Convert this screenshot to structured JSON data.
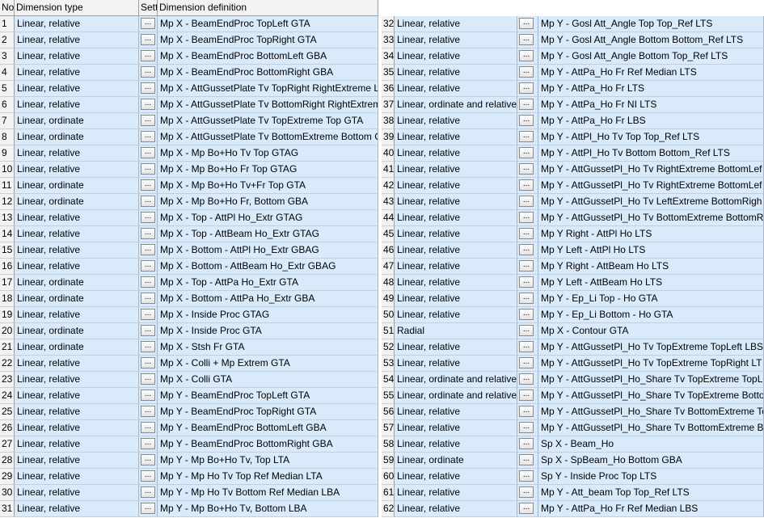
{
  "header": {
    "no": "No",
    "type": "Dimension type",
    "set": "Sett",
    "def": "Dimension definition"
  },
  "settings_button_label": "...",
  "left_rows": [
    {
      "no": "1",
      "type": "Linear, relative",
      "def": "Mp X - BeamEndProc TopLeft GTA"
    },
    {
      "no": "2",
      "type": "Linear, relative",
      "def": "Mp X - BeamEndProc TopRight GTA"
    },
    {
      "no": "3",
      "type": "Linear, relative",
      "def": "Mp X - BeamEndProc BottomLeft GBA"
    },
    {
      "no": "4",
      "type": "Linear, relative",
      "def": "Mp X - BeamEndProc BottomRight GBA"
    },
    {
      "no": "5",
      "type": "Linear, relative",
      "def": "Mp X - AttGussetPlate Tv TopRight RightExtreme LT"
    },
    {
      "no": "6",
      "type": "Linear, relative",
      "def": "Mp X - AttGussetPlate Tv BottomRight RightExtrem"
    },
    {
      "no": "7",
      "type": "Linear, ordinate",
      "def": "Mp X - AttGussetPlate Tv TopExtreme Top GTA"
    },
    {
      "no": "8",
      "type": "Linear, ordinate",
      "def": "Mp X - AttGussetPlate Tv BottomExtreme Bottom G"
    },
    {
      "no": "9",
      "type": "Linear, relative",
      "def": "Mp X - Mp Bo+Ho Tv Top GTAG"
    },
    {
      "no": "10",
      "type": "Linear, relative",
      "def": "Mp X - Mp Bo+Ho Fr Top GTAG"
    },
    {
      "no": "11",
      "type": "Linear, ordinate",
      "def": "Mp X - Mp Bo+Ho Tv+Fr Top GTA"
    },
    {
      "no": "12",
      "type": "Linear, ordinate",
      "def": "Mp X - Mp Bo+Ho Fr, Bottom GBA"
    },
    {
      "no": "13",
      "type": "Linear, relative",
      "def": "Mp X - Top - AttPl Ho_Extr GTAG"
    },
    {
      "no": "14",
      "type": "Linear, relative",
      "def": "Mp X - Top - AttBeam Ho_Extr GTAG"
    },
    {
      "no": "15",
      "type": "Linear, relative",
      "def": "Mp X - Bottom - AttPl Ho_Extr GBAG"
    },
    {
      "no": "16",
      "type": "Linear, relative",
      "def": "Mp X - Bottom - AttBeam Ho_Extr GBAG"
    },
    {
      "no": "17",
      "type": "Linear, ordinate",
      "def": "Mp X - Top - AttPa Ho_Extr GTA"
    },
    {
      "no": "18",
      "type": "Linear, ordinate",
      "def": "Mp X - Bottom - AttPa Ho_Extr GBA"
    },
    {
      "no": "19",
      "type": "Linear, relative",
      "def": "Mp X - Inside Proc GTAG"
    },
    {
      "no": "20",
      "type": "Linear, ordinate",
      "def": "Mp X - Inside Proc GTA"
    },
    {
      "no": "21",
      "type": "Linear, ordinate",
      "def": "Mp X - Stsh Fr GTA"
    },
    {
      "no": "22",
      "type": "Linear, relative",
      "def": "Mp X - Colli + Mp Extrem GTA"
    },
    {
      "no": "23",
      "type": "Linear, relative",
      "def": "Mp X - Colli GTA"
    },
    {
      "no": "24",
      "type": "Linear, relative",
      "def": "Mp Y - BeamEndProc TopLeft GTA"
    },
    {
      "no": "25",
      "type": "Linear, relative",
      "def": "Mp Y - BeamEndProc TopRight GTA"
    },
    {
      "no": "26",
      "type": "Linear, relative",
      "def": "Mp Y - BeamEndProc BottomLeft GBA"
    },
    {
      "no": "27",
      "type": "Linear, relative",
      "def": "Mp Y - BeamEndProc BottomRight GBA"
    },
    {
      "no": "28",
      "type": "Linear, relative",
      "def": "Mp Y - Mp Bo+Ho Tv, Top LTA"
    },
    {
      "no": "29",
      "type": "Linear, relative",
      "def": "Mp Y - Mp Ho Tv Top Ref Median LTA"
    },
    {
      "no": "30",
      "type": "Linear, relative",
      "def": "Mp Y - Mp Ho Tv Bottom Ref Median LBA"
    },
    {
      "no": "31",
      "type": "Linear, relative",
      "def": "Mp Y - Mp Bo+Ho Tv, Bottom LBA"
    }
  ],
  "right_rows": [
    {
      "no": "32",
      "type": "Linear, relative",
      "def": "Mp Y - Gosl Att_Angle Top Top_Ref LTS"
    },
    {
      "no": "33",
      "type": "Linear, relative",
      "def": "Mp Y - Gosl Att_Angle Bottom Bottom_Ref LTS"
    },
    {
      "no": "34",
      "type": "Linear, relative",
      "def": "Mp Y - Gosl Att_Angle Bottom Top_Ref LTS"
    },
    {
      "no": "35",
      "type": "Linear, relative",
      "def": "Mp Y - AttPa_Ho Fr Ref Median LTS"
    },
    {
      "no": "36",
      "type": "Linear, relative",
      "def": "Mp Y - AttPa_Ho Fr LTS"
    },
    {
      "no": "37",
      "type": "Linear, ordinate and relative",
      "def": "Mp Y - AttPa_Ho Fr NI LTS"
    },
    {
      "no": "38",
      "type": "Linear, relative",
      "def": "Mp Y - AttPa_Ho Fr LBS"
    },
    {
      "no": "39",
      "type": "Linear, relative",
      "def": "Mp Y - AttPl_Ho Tv Top Top_Ref LTS"
    },
    {
      "no": "40",
      "type": "Linear, relative",
      "def": "Mp Y - AttPl_Ho Tv Bottom Bottom_Ref LTS"
    },
    {
      "no": "41",
      "type": "Linear, relative",
      "def": "Mp Y - AttGussetPl_Ho Tv RightExtreme BottomLef"
    },
    {
      "no": "42",
      "type": "Linear, relative",
      "def": "Mp Y - AttGussetPl_Ho Tv RightExtreme BottomLef"
    },
    {
      "no": "43",
      "type": "Linear, relative",
      "def": "Mp Y - AttGussetPl_Ho Tv LeftExtreme BottomRigh"
    },
    {
      "no": "44",
      "type": "Linear, relative",
      "def": "Mp Y - AttGussetPl_Ho Tv BottomExtreme BottomR"
    },
    {
      "no": "45",
      "type": "Linear, relative",
      "def": "Mp Y Right - AttPl Ho LTS"
    },
    {
      "no": "46",
      "type": "Linear, relative",
      "def": "Mp Y Left - AttPl Ho LTS"
    },
    {
      "no": "47",
      "type": "Linear, relative",
      "def": "Mp Y Right - AttBeam Ho LTS"
    },
    {
      "no": "48",
      "type": "Linear, relative",
      "def": "Mp Y Left - AttBeam Ho LTS"
    },
    {
      "no": "49",
      "type": "Linear, relative",
      "def": "Mp Y - Ep_Li Top - Ho GTA"
    },
    {
      "no": "50",
      "type": "Linear, relative",
      "def": "Mp Y - Ep_Li Bottom - Ho GTA"
    },
    {
      "no": "51",
      "type": "Radial",
      "def": "Mp X - Contour GTA"
    },
    {
      "no": "52",
      "type": "Linear, relative",
      "def": "Mp Y - AttGussetPl_Ho Tv TopExtreme TopLeft LBS"
    },
    {
      "no": "53",
      "type": "Linear, relative",
      "def": "Mp Y - AttGussetPl_Ho Tv TopExtreme TopRight LT"
    },
    {
      "no": "54",
      "type": "Linear, ordinate and relative",
      "def": "Mp Y - AttGussetPl_Ho_Share Tv TopExtreme TopLe"
    },
    {
      "no": "55",
      "type": "Linear, ordinate and relative",
      "def": "Mp Y - AttGussetPl_Ho_Share Tv TopExtreme Botto"
    },
    {
      "no": "56",
      "type": "Linear, relative",
      "def": "Mp Y - AttGussetPl_Ho_Share Tv BottomExtreme To"
    },
    {
      "no": "57",
      "type": "Linear, relative",
      "def": "Mp Y - AttGussetPl_Ho_Share Tv BottomExtreme Bo"
    },
    {
      "no": "58",
      "type": "Linear, relative",
      "def": "Sp X - Beam_Ho"
    },
    {
      "no": "59",
      "type": "Linear, ordinate",
      "def": "Sp X - SpBeam_Ho Bottom GBA"
    },
    {
      "no": "60",
      "type": "Linear, relative",
      "def": "Sp Y - Inside Proc Top LTS"
    },
    {
      "no": "61",
      "type": "Linear, relative",
      "def": "Mp Y - Att_beam Top Top_Ref LTS"
    },
    {
      "no": "62",
      "type": "Linear, relative",
      "def": "Mp Y - AttPa_Ho Fr Ref Median LBS"
    }
  ]
}
